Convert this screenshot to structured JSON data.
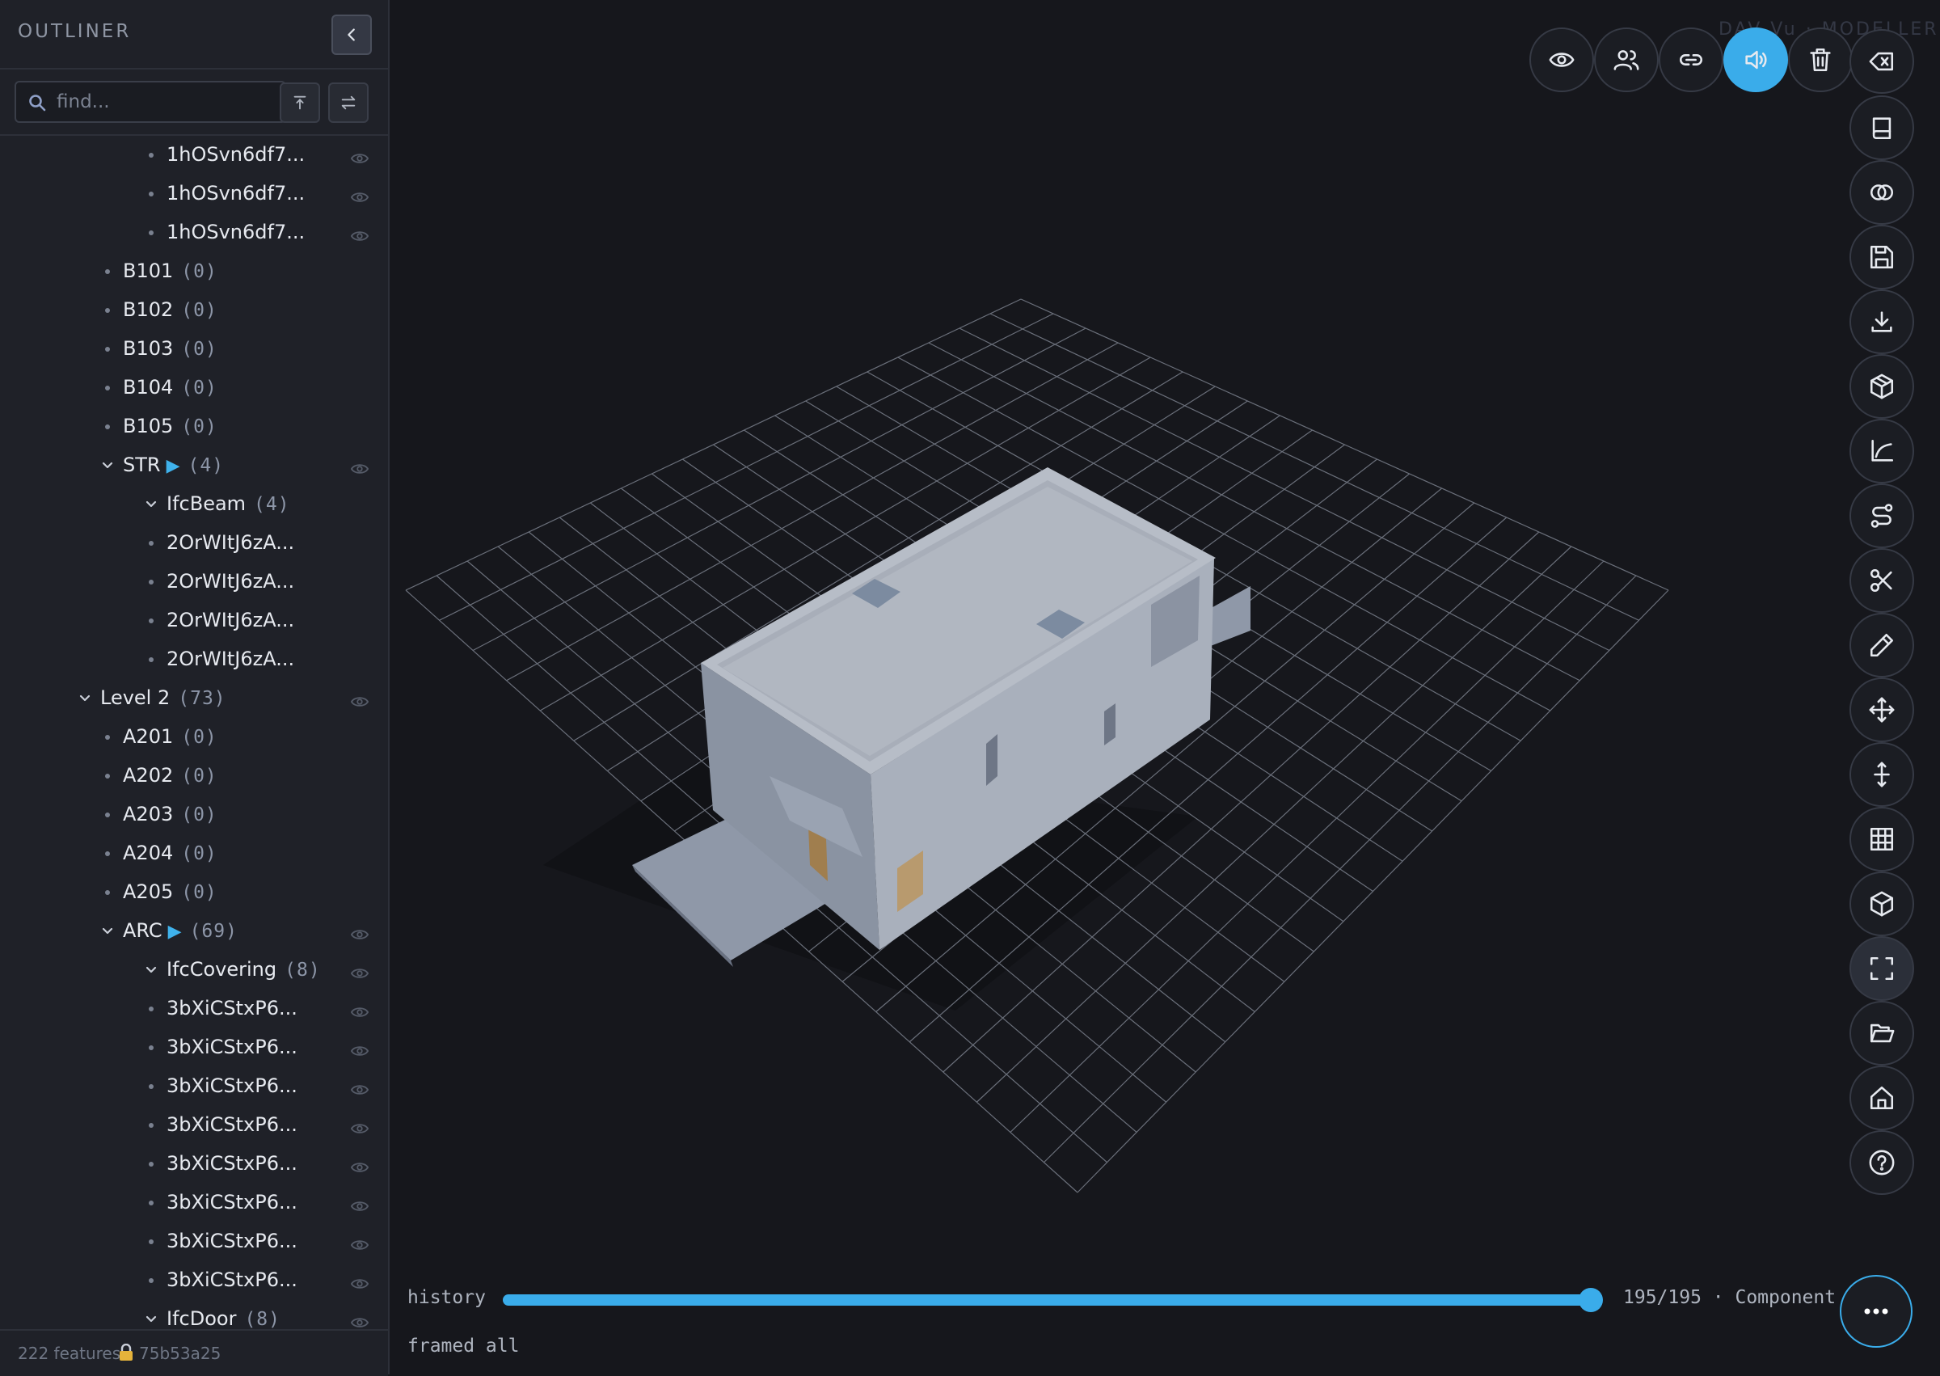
{
  "sidebar": {
    "title": "OUTLINER",
    "search_placeholder": "find...",
    "footer": {
      "features": "222 features",
      "hash": "75b53a25"
    }
  },
  "tree": [
    {
      "label": "1hOSvn6df7...",
      "count": "",
      "expanded": null,
      "eye": true,
      "play": false
    },
    {
      "label": "1hOSvn6df7...",
      "count": "",
      "expanded": null,
      "eye": true,
      "play": false
    },
    {
      "label": "1hOSvn6df7...",
      "count": "",
      "expanded": null,
      "eye": true,
      "play": false
    },
    {
      "label": "B101",
      "count": "(0)",
      "expanded": null,
      "eye": false,
      "play": false
    },
    {
      "label": "B102",
      "count": "(0)",
      "expanded": null,
      "eye": false,
      "play": false
    },
    {
      "label": "B103",
      "count": "(0)",
      "expanded": null,
      "eye": false,
      "play": false
    },
    {
      "label": "B104",
      "count": "(0)",
      "expanded": null,
      "eye": false,
      "play": false
    },
    {
      "label": "B105",
      "count": "(0)",
      "expanded": null,
      "eye": false,
      "play": false
    },
    {
      "label": "STR",
      "count": "(4)",
      "expanded": true,
      "eye": true,
      "play": true
    },
    {
      "label": "IfcBeam",
      "count": "(4)",
      "expanded": true,
      "eye": false,
      "play": false
    },
    {
      "label": "2OrWItJ6zA...",
      "count": "",
      "expanded": null,
      "eye": false,
      "play": false
    },
    {
      "label": "2OrWItJ6zA...",
      "count": "",
      "expanded": null,
      "eye": false,
      "play": false
    },
    {
      "label": "2OrWItJ6zA...",
      "count": "",
      "expanded": null,
      "eye": false,
      "play": false
    },
    {
      "label": "2OrWItJ6zA...",
      "count": "",
      "expanded": null,
      "eye": false,
      "play": false
    },
    {
      "label": "Level 2",
      "count": "(73)",
      "expanded": true,
      "eye": true,
      "play": false
    },
    {
      "label": "A201",
      "count": "(0)",
      "expanded": null,
      "eye": false,
      "play": false
    },
    {
      "label": "A202",
      "count": "(0)",
      "expanded": null,
      "eye": false,
      "play": false
    },
    {
      "label": "A203",
      "count": "(0)",
      "expanded": null,
      "eye": false,
      "play": false
    },
    {
      "label": "A204",
      "count": "(0)",
      "expanded": null,
      "eye": false,
      "play": false
    },
    {
      "label": "A205",
      "count": "(0)",
      "expanded": null,
      "eye": false,
      "play": false
    },
    {
      "label": "ARC",
      "count": "(69)",
      "expanded": true,
      "eye": true,
      "play": true
    },
    {
      "label": "IfcCovering",
      "count": "(8)",
      "expanded": true,
      "eye": true,
      "play": false
    },
    {
      "label": "3bXiCStxP6...",
      "count": "",
      "expanded": null,
      "eye": true,
      "play": false
    },
    {
      "label": "3bXiCStxP6...",
      "count": "",
      "expanded": null,
      "eye": true,
      "play": false
    },
    {
      "label": "3bXiCStxP6...",
      "count": "",
      "expanded": null,
      "eye": true,
      "play": false
    },
    {
      "label": "3bXiCStxP6...",
      "count": "",
      "expanded": null,
      "eye": true,
      "play": false
    },
    {
      "label": "3bXiCStxP6...",
      "count": "",
      "expanded": null,
      "eye": true,
      "play": false
    },
    {
      "label": "3bXiCStxP6...",
      "count": "",
      "expanded": null,
      "eye": true,
      "play": false
    },
    {
      "label": "3bXiCStxP6...",
      "count": "",
      "expanded": null,
      "eye": true,
      "play": false
    },
    {
      "label": "3bXiCStxP6...",
      "count": "",
      "expanded": null,
      "eye": true,
      "play": false
    },
    {
      "label": "IfcDoor",
      "count": "(8)",
      "expanded": true,
      "eye": true,
      "play": false
    }
  ],
  "viewport": {
    "brand": "DAV Vu · MODELLER",
    "history_label": "history",
    "history_progress": 1.0,
    "counter": "195/195 · Component",
    "status": "framed all"
  },
  "toolbar_top": [
    {
      "icon": "eye-icon",
      "active": false
    },
    {
      "icon": "users-icon",
      "active": false
    },
    {
      "icon": "link-icon",
      "active": false
    },
    {
      "icon": "speaker-icon",
      "active": true
    },
    {
      "icon": "trash-icon",
      "active": false
    },
    {
      "icon": "clear-icon",
      "active": false
    }
  ],
  "toolbar_right": [
    {
      "icon": "book-icon"
    },
    {
      "icon": "intersect-icon"
    },
    {
      "icon": "save-icon"
    },
    {
      "icon": "download-icon"
    },
    {
      "icon": "package-icon"
    },
    {
      "icon": "curve-icon"
    },
    {
      "icon": "route-icon"
    },
    {
      "icon": "scissors-icon"
    },
    {
      "icon": "pencil-icon"
    },
    {
      "icon": "move-icon"
    },
    {
      "icon": "vertical-move-icon"
    },
    {
      "icon": "grid-icon"
    },
    {
      "icon": "cube-icon"
    },
    {
      "icon": "fit-view-icon"
    },
    {
      "icon": "folder-open-icon"
    },
    {
      "icon": "home-icon"
    },
    {
      "icon": "help-icon"
    }
  ],
  "colors": {
    "accent": "#3aacea",
    "panel": "#1f2128",
    "background": "#16171c"
  }
}
